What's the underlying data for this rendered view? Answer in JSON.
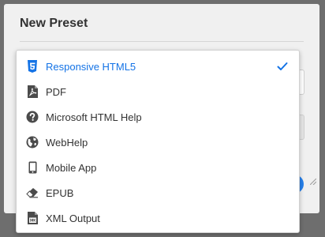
{
  "dialog": {
    "title": "New Preset"
  },
  "dropdown": {
    "selected_index": 0,
    "items": [
      {
        "label": "Responsive HTML5",
        "icon": "html5-icon",
        "selected": true
      },
      {
        "label": "PDF",
        "icon": "pdf-icon",
        "selected": false
      },
      {
        "label": "Microsoft HTML Help",
        "icon": "help-icon",
        "selected": false
      },
      {
        "label": "WebHelp",
        "icon": "globe-icon",
        "selected": false
      },
      {
        "label": "Mobile App",
        "icon": "mobile-icon",
        "selected": false
      },
      {
        "label": "EPUB",
        "icon": "eraser-icon",
        "selected": false
      },
      {
        "label": "XML Output",
        "icon": "xml-file-icon",
        "selected": false
      }
    ]
  },
  "colors": {
    "accent": "#1473e6",
    "text": "#323232",
    "icon": "#4b4b4b",
    "primary_button": "#2680eb"
  }
}
